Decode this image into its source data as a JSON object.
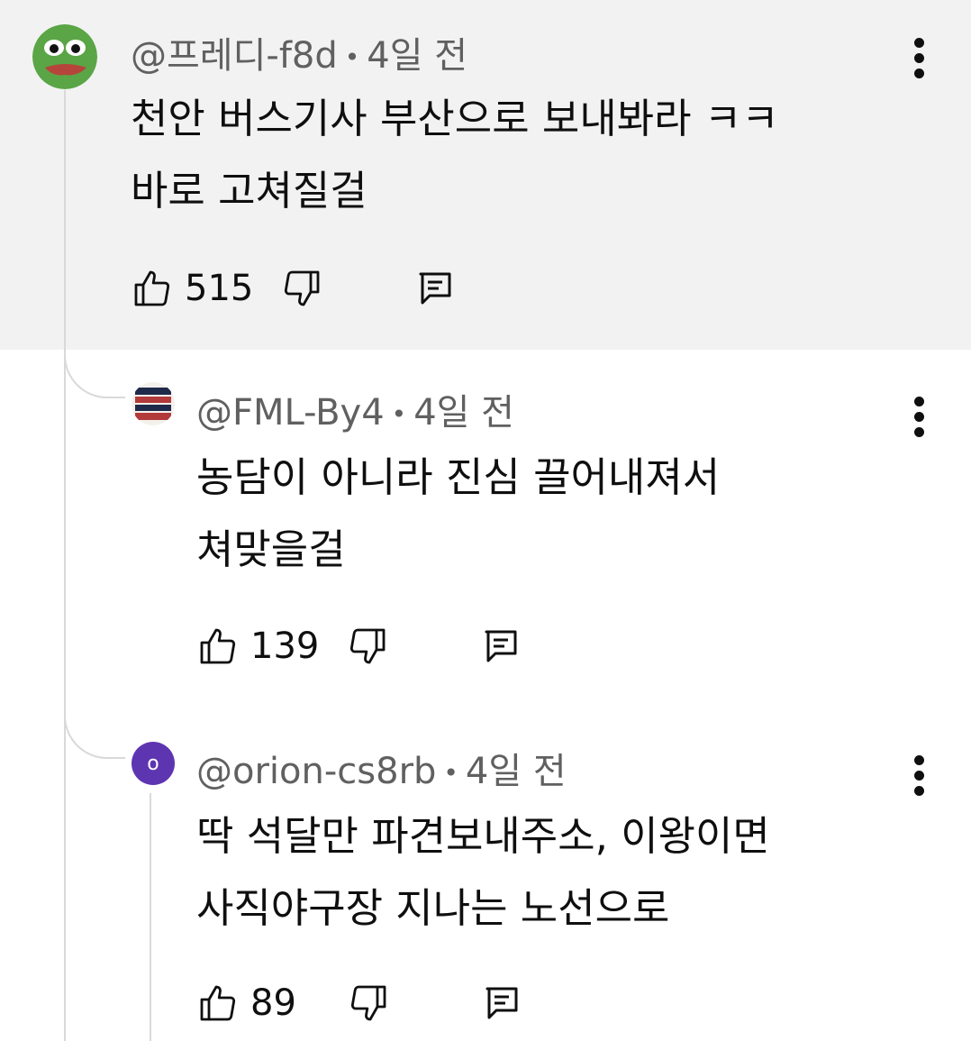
{
  "comments": [
    {
      "author": "@프레디-f8d",
      "time": "4일 전",
      "text": "천안 버스기사 부산으로 보내봐라 ㅋㅋ\n바로 고쳐질걸",
      "likes": "515",
      "avatar_icon": "pepe-frog-avatar"
    },
    {
      "author": "@FML-By4",
      "time": "4일 전",
      "text": "농담이 아니라 진심 끌어내져서\n쳐맞을걸",
      "likes": "139",
      "avatar_icon": "poster-avatar"
    },
    {
      "author": "@orion-cs8rb",
      "time": "4일 전",
      "text": "딱 석달만 파견보내주소, 이왕이면\n사직야구장 지나는 노선으로",
      "likes": "89",
      "avatar_letter": "o",
      "avatar_color": "#5e35b1"
    }
  ],
  "colors": {
    "highlight_bg": "#f2f2f2",
    "meta": "#606060",
    "thread_line": "#d9d9d9"
  }
}
